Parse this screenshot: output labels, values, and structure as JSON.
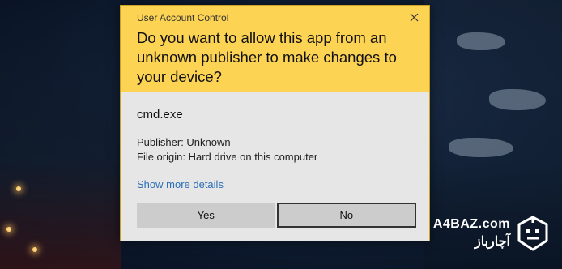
{
  "dialog": {
    "title": "User Account Control",
    "question": "Do you want to allow this app from an unknown publisher to make changes to your device?",
    "app_name": "cmd.exe",
    "publisher": "Publisher: Unknown",
    "file_origin": "File origin: Hard drive on this computer",
    "more_details": "Show more details",
    "yes_label": "Yes",
    "no_label": "No",
    "header_color": "#fdd353",
    "link_color": "#2a6fb7"
  },
  "watermark": {
    "latin": "A4BAZ.com",
    "persian": "آچارباز",
    "logo_icon": "robot-head-icon"
  }
}
